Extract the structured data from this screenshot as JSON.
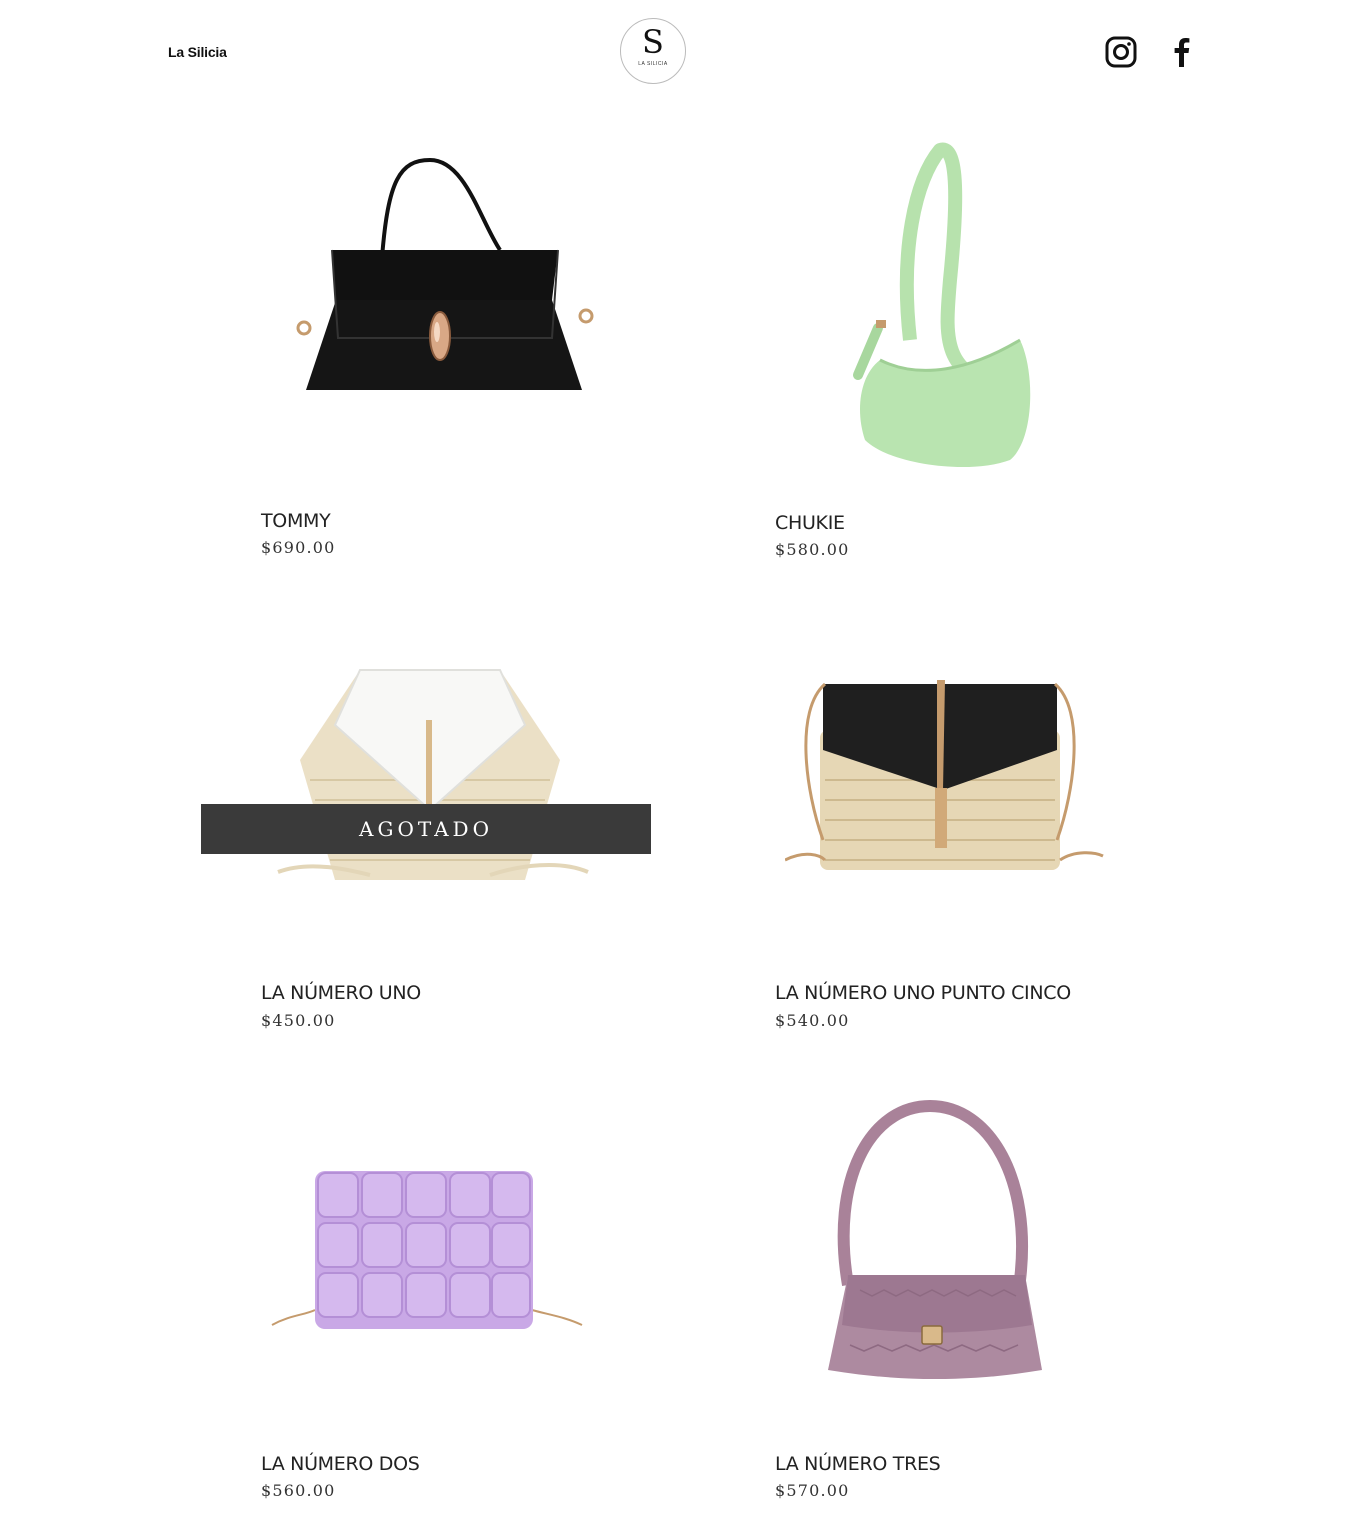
{
  "header": {
    "brand": "La Silicia",
    "logo_letter": "S",
    "logo_text": "LA SILICIA",
    "instagram_icon": "instagram-icon",
    "facebook_icon": "facebook-icon"
  },
  "products": [
    {
      "name": "TOMMY",
      "price": "$690.00",
      "color": "#1a1a1a"
    },
    {
      "name": "CHUKIE",
      "price": "$580.00",
      "color": "#b9e3b1"
    },
    {
      "name": "LA NÚMERO UNO",
      "price": "$450.00",
      "sold_out": "AGOTADO",
      "color": "#e8dcc2"
    },
    {
      "name": "LA NÚMERO UNO PUNTO CINCO",
      "price": "$540.00",
      "color": "#222222"
    },
    {
      "name": "LA NÚMERO DOS",
      "price": "$560.00",
      "color": "#c9a6e4"
    },
    {
      "name": "LA NÚMERO TRES",
      "price": "$570.00",
      "color": "#a98299"
    }
  ]
}
